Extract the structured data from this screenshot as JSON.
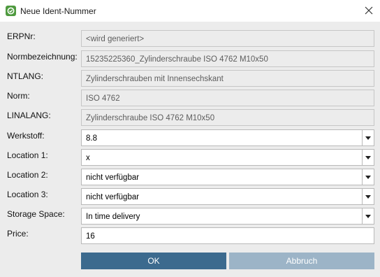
{
  "window": {
    "title": "Neue Ident-Nummer"
  },
  "fields": [
    {
      "label": "ERPNr:",
      "value": "<wird generiert>",
      "kind": "readonly"
    },
    {
      "label": "Normbezeichnung:",
      "value": "15235225360_Zylinderschraube ISO 4762 M10x50",
      "kind": "readonly"
    },
    {
      "label": "NTLANG:",
      "value": "Zylinderschrauben mit Innensechskant",
      "kind": "readonly"
    },
    {
      "label": "Norm:",
      "value": "ISO 4762",
      "kind": "readonly"
    },
    {
      "label": "LINALANG:",
      "value": "Zylinderschraube ISO 4762 M10x50",
      "kind": "readonly"
    },
    {
      "label": "Werkstoff:",
      "value": "8.8",
      "kind": "combo"
    },
    {
      "label": "Location 1:",
      "value": "x",
      "kind": "combo"
    },
    {
      "label": "Location 2:",
      "value": "nicht verfügbar",
      "kind": "combo"
    },
    {
      "label": "Location 3:",
      "value": "nicht verfügbar",
      "kind": "combo"
    },
    {
      "label": "Storage Space:",
      "value": "In time delivery",
      "kind": "combo"
    },
    {
      "label": "Price:",
      "value": "16",
      "kind": "input"
    }
  ],
  "buttons": {
    "ok": "OK",
    "cancel": "Abbruch"
  },
  "icons": {
    "app": "app-logo-icon",
    "close": "close-icon",
    "dropdown": "chevron-down-icon"
  },
  "colors": {
    "ok_button": "#3c6a8e",
    "cancel_button": "#9cb4c7",
    "dialog_background": "#ececec",
    "app_icon": "#4f9a3f"
  }
}
